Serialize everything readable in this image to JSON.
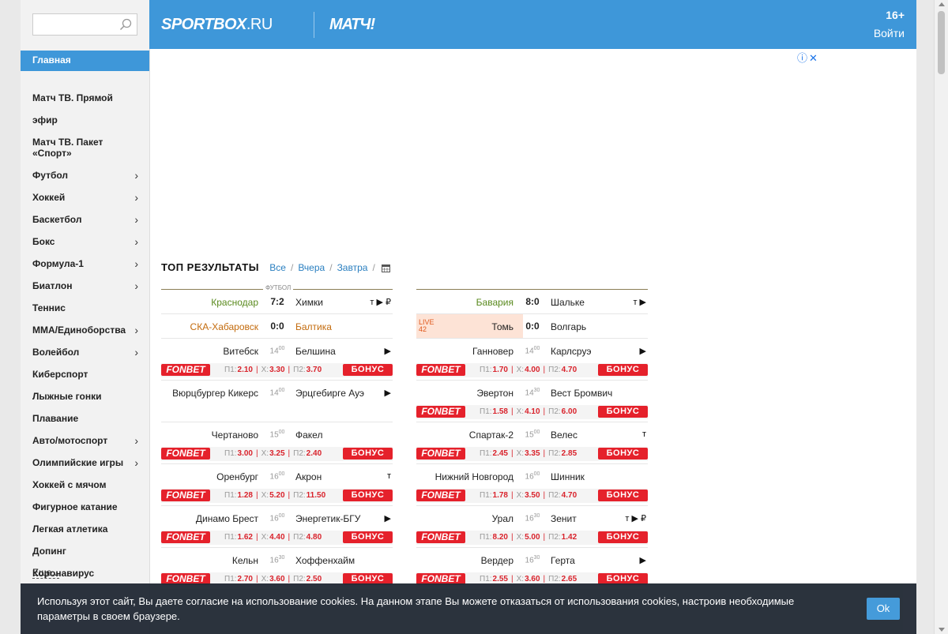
{
  "header": {
    "logo_sportbox": "SPORTBOX",
    "logo_ru": ".RU",
    "logo_match": "МАТЧ!",
    "age_rating": "16+",
    "login_label": "Войти"
  },
  "search": {
    "placeholder": "",
    "value": ""
  },
  "sidebar": {
    "home_label": "Главная",
    "items": [
      {
        "label": "Матч ТВ. Прямой эфир",
        "chevron": false
      },
      {
        "label": "Матч ТВ. Пакет «Спорт»",
        "chevron": false
      },
      {
        "label": "Футбол",
        "chevron": true
      },
      {
        "label": "Хоккей",
        "chevron": true
      },
      {
        "label": "Баскетбол",
        "chevron": true
      },
      {
        "label": "Бокс",
        "chevron": true
      },
      {
        "label": "Формула-1",
        "chevron": true
      },
      {
        "label": "Биатлон",
        "chevron": true
      },
      {
        "label": "Теннис",
        "chevron": false
      },
      {
        "label": "ММА/Единоборства",
        "chevron": true
      },
      {
        "label": "Волейбол",
        "chevron": true
      },
      {
        "label": "Киберспорт",
        "chevron": false
      },
      {
        "label": "Лыжные гонки",
        "chevron": false
      },
      {
        "label": "Плавание",
        "chevron": false
      },
      {
        "label": "Авто/мотоспорт",
        "chevron": true
      },
      {
        "label": "Олимпийские игры",
        "chevron": true
      },
      {
        "label": "Хоккей с мячом",
        "chevron": false
      },
      {
        "label": "Фигурное катание",
        "chevron": false
      },
      {
        "label": "Легкая атлетика",
        "chevron": false
      },
      {
        "label": "Допинг",
        "chevron": false
      },
      {
        "label": "Коронавирус",
        "chevron": false
      }
    ],
    "more_label": "Еще..."
  },
  "results": {
    "title": "ТОП РЕЗУЛЬТАТЫ",
    "filters": [
      "Все",
      "Вчера",
      "Завтра"
    ],
    "sport_label": "ФУТБОЛ",
    "left": [
      {
        "home": "Краснодар",
        "away": "Химки",
        "score": "7:2",
        "home_state": "win",
        "away_state": "",
        "flags": "т ▶ ₽"
      },
      {
        "home": "СКА-Хабаровск",
        "away": "Балтика",
        "score": "0:0",
        "home_state": "draw",
        "away_state": "draw",
        "flags": ""
      },
      {
        "home": "Витебск",
        "away": "Белшина",
        "time": "14",
        "time_min": "00",
        "flags": "▶",
        "odds": {
          "p1": "2.10",
          "x": "3.30",
          "p2": "3.70"
        }
      },
      {
        "home": "Вюрцбургер Кикерс",
        "away": "Эрцгебирге Ауэ",
        "time": "14",
        "time_min": "00",
        "flags": "▶",
        "odds": null
      },
      {
        "home": "Чертаново",
        "away": "Факел",
        "time": "15",
        "time_min": "00",
        "flags": "",
        "odds": {
          "p1": "3.00",
          "x": "3.25",
          "p2": "2.40"
        }
      },
      {
        "home": "Оренбург",
        "away": "Акрон",
        "time": "16",
        "time_min": "00",
        "flags": "т",
        "odds": {
          "p1": "1.28",
          "x": "5.20",
          "p2": "11.50"
        }
      },
      {
        "home": "Динамо Брест",
        "away": "Энергетик-БГУ",
        "time": "16",
        "time_min": "00",
        "flags": "▶",
        "odds": {
          "p1": "1.62",
          "x": "4.40",
          "p2": "4.80"
        }
      },
      {
        "home": "Кельн",
        "away": "Хоффенхайм",
        "time": "16",
        "time_min": "30",
        "flags": "",
        "odds": {
          "p1": "2.70",
          "x": "3.60",
          "p2": "2.50"
        }
      }
    ],
    "right": [
      {
        "home": "Бавария",
        "away": "Шальке",
        "score": "8:0",
        "home_state": "win",
        "away_state": "",
        "flags": "т ▶"
      },
      {
        "home": "Томь",
        "away": "Волгарь",
        "score": "0:0",
        "live": true,
        "live_label": "LIVE",
        "live_minute": "42",
        "flags": ""
      },
      {
        "home": "Ганновер",
        "away": "Карлсруэ",
        "time": "14",
        "time_min": "00",
        "flags": "▶",
        "odds": {
          "p1": "1.70",
          "x": "4.00",
          "p2": "4.70"
        }
      },
      {
        "home": "Эвертон",
        "away": "Вест Бромвич",
        "time": "14",
        "time_min": "30",
        "flags": "",
        "odds": {
          "p1": "1.58",
          "x": "4.10",
          "p2": "6.00"
        }
      },
      {
        "home": "Спартак-2",
        "away": "Велес",
        "time": "15",
        "time_min": "00",
        "flags": "т",
        "odds": {
          "p1": "2.45",
          "x": "3.35",
          "p2": "2.85"
        }
      },
      {
        "home": "Нижний Новгород",
        "away": "Шинник",
        "time": "16",
        "time_min": "00",
        "flags": "",
        "odds": {
          "p1": "1.78",
          "x": "3.50",
          "p2": "4.70"
        }
      },
      {
        "home": "Урал",
        "away": "Зенит",
        "time": "16",
        "time_min": "30",
        "flags": "т ▶ ₽",
        "odds": {
          "p1": "8.20",
          "x": "5.00",
          "p2": "1.42"
        }
      },
      {
        "home": "Вердер",
        "away": "Герта",
        "time": "16",
        "time_min": "30",
        "flags": "▶",
        "odds": {
          "p1": "2.55",
          "x": "3.60",
          "p2": "2.65"
        }
      }
    ],
    "bookmaker_label": "FONBET",
    "bonus_label": "БОНУС",
    "p1_label": "П1:",
    "x_label": "Х:",
    "p2_label": "П2:"
  },
  "cookie": {
    "text": "Используя этот сайт, Вы даете согласие на использование cookies. На данном этапе Вы можете отказаться от использования cookies, настроив необходимые параметры в своем браузере.",
    "ok_label": "Ok"
  },
  "colors": {
    "brand_blue": "#3e97d9",
    "win_green": "#5a8a1e",
    "draw_orange": "#c36b0d",
    "fonbet_red": "#e5212b",
    "cookie_bg": "#232b36"
  }
}
